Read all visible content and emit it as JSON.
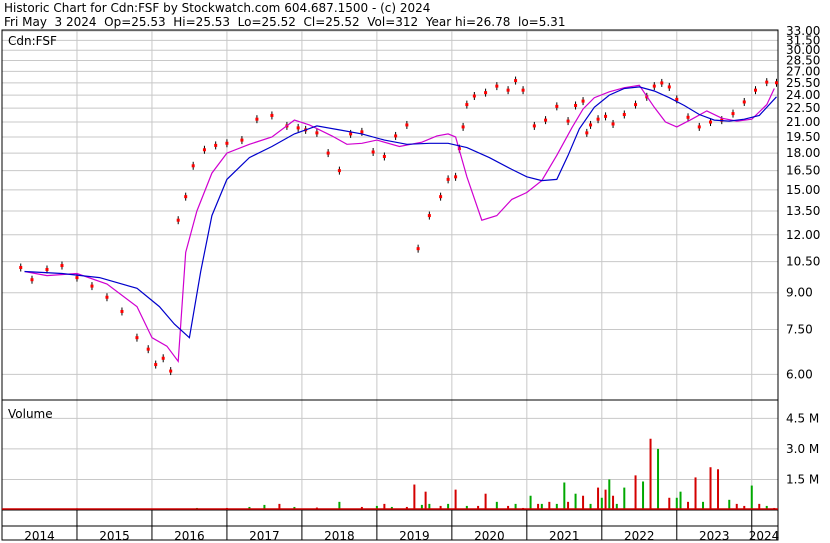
{
  "header": {
    "line1": "Historic Chart for Cdn:FSF by Stockwatch.com 604.687.1500 - (c) 2024",
    "line2": "Fri May  3 2024  Op=25.53  Hi=25.53  Lo=25.52  Cl=25.52  Vol=312  Year hi=26.78  lo=5.31"
  },
  "panels": {
    "price_label": "Cdn:FSF",
    "volume_label": "Volume"
  },
  "colors": {
    "up": "#00a800",
    "down": "#d40000",
    "close_dot": "#ff0000",
    "ma_short": "#d000d0",
    "ma_long": "#0000cc",
    "grid": "#c8c8c8",
    "frame": "#000000"
  },
  "chart_data": [
    {
      "type": "line",
      "panel": "price",
      "title": "Cdn:FSF",
      "y_scale": "log",
      "ylim": [
        5.31,
        33.0
      ],
      "y_ticks": [
        "33.00",
        "31.50",
        "30.00",
        "28.50",
        "27.00",
        "25.50",
        "24.00",
        "22.50",
        "21.00",
        "19.50",
        "18.00",
        "16.50",
        "15.00",
        "13.50",
        "12.00",
        "10.50",
        "9.00",
        "7.50",
        "6.00"
      ],
      "x_ticks": [
        "2014",
        "2015",
        "2016",
        "2017",
        "2018",
        "2019",
        "2020",
        "2021",
        "2022",
        "2023",
        "2024"
      ],
      "xlim": [
        2014.0,
        2024.35
      ],
      "series": [
        {
          "kind": "close",
          "x": [
            2014.25,
            2014.4,
            2014.6,
            2014.8,
            2015.0,
            2015.2,
            2015.4,
            2015.6,
            2015.8,
            2015.95,
            2016.05,
            2016.15,
            2016.25,
            2016.35,
            2016.45,
            2016.55,
            2016.7,
            2016.85,
            2017.0,
            2017.2,
            2017.4,
            2017.6,
            2017.8,
            2017.95,
            2018.05,
            2018.2,
            2018.35,
            2018.5,
            2018.65,
            2018.8,
            2018.95,
            2019.1,
            2019.25,
            2019.4,
            2019.55,
            2019.7,
            2019.85,
            2019.95,
            2020.05,
            2020.1,
            2020.15,
            2020.2,
            2020.3,
            2020.45,
            2020.6,
            2020.75,
            2020.85,
            2020.95,
            2021.1,
            2021.25,
            2021.4,
            2021.55,
            2021.65,
            2021.75,
            2021.8,
            2021.85,
            2021.95,
            2022.05,
            2022.15,
            2022.3,
            2022.45,
            2022.6,
            2022.7,
            2022.8,
            2022.9,
            2023.0,
            2023.15,
            2023.3,
            2023.45,
            2023.6,
            2023.75,
            2023.9,
            2024.05,
            2024.2,
            2024.33
          ],
          "values": [
            10.2,
            9.6,
            10.1,
            10.3,
            9.7,
            9.3,
            8.8,
            8.2,
            7.2,
            6.8,
            6.3,
            6.5,
            6.1,
            12.9,
            14.5,
            16.9,
            18.3,
            18.7,
            18.9,
            19.2,
            21.3,
            21.7,
            20.6,
            20.4,
            20.2,
            19.9,
            18.0,
            16.5,
            19.8,
            20.0,
            18.1,
            17.7,
            19.6,
            20.7,
            11.2,
            13.2,
            14.5,
            15.8,
            16.0,
            18.4,
            20.5,
            22.9,
            23.9,
            24.3,
            25.1,
            24.6,
            25.8,
            24.6,
            20.6,
            21.2,
            22.7,
            21.1,
            22.8,
            23.3,
            19.9,
            20.7,
            21.3,
            21.6,
            20.8,
            21.8,
            22.9,
            23.8,
            25.1,
            25.5,
            25.0,
            23.5,
            21.5,
            20.5,
            21.0,
            21.2,
            21.9,
            23.2,
            24.6,
            25.6,
            25.52
          ]
        },
        {
          "kind": "ma_short",
          "x": [
            2014.3,
            2014.6,
            2015.0,
            2015.4,
            2015.8,
            2016.0,
            2016.2,
            2016.35,
            2016.45,
            2016.6,
            2016.8,
            2017.0,
            2017.3,
            2017.6,
            2017.9,
            2018.1,
            2018.4,
            2018.6,
            2018.8,
            2019.0,
            2019.3,
            2019.6,
            2019.8,
            2019.95,
            2020.05,
            2020.2,
            2020.4,
            2020.6,
            2020.8,
            2021.0,
            2021.2,
            2021.4,
            2021.6,
            2021.75,
            2021.9,
            2022.1,
            2022.3,
            2022.5,
            2022.7,
            2022.85,
            2023.0,
            2023.2,
            2023.4,
            2023.6,
            2023.8,
            2024.0,
            2024.2,
            2024.3
          ],
          "values": [
            10.0,
            9.8,
            9.9,
            9.4,
            8.4,
            7.2,
            6.9,
            6.4,
            11.0,
            13.5,
            16.3,
            18.0,
            18.8,
            19.5,
            21.2,
            20.7,
            19.6,
            18.8,
            18.9,
            19.2,
            18.6,
            19.0,
            19.6,
            19.8,
            19.5,
            16.0,
            12.9,
            13.2,
            14.3,
            14.8,
            15.7,
            17.8,
            20.4,
            22.4,
            23.7,
            24.4,
            24.9,
            25.2,
            22.6,
            21.0,
            20.5,
            21.3,
            22.2,
            21.4,
            21.1,
            21.3,
            22.9,
            24.8
          ]
        },
        {
          "kind": "ma_long",
          "x": [
            2014.3,
            2014.8,
            2015.3,
            2015.8,
            2016.1,
            2016.3,
            2016.5,
            2016.65,
            2016.8,
            2017.0,
            2017.3,
            2017.6,
            2017.9,
            2018.2,
            2018.5,
            2018.8,
            2019.1,
            2019.4,
            2019.7,
            2019.95,
            2020.2,
            2020.5,
            2020.8,
            2021.0,
            2021.2,
            2021.4,
            2021.55,
            2021.7,
            2021.9,
            2022.1,
            2022.3,
            2022.5,
            2022.7,
            2022.9,
            2023.1,
            2023.3,
            2023.5,
            2023.7,
            2023.9,
            2024.1,
            2024.33
          ],
          "values": [
            10.0,
            9.9,
            9.7,
            9.2,
            8.4,
            7.7,
            7.2,
            10.0,
            13.2,
            15.8,
            17.6,
            18.6,
            19.8,
            20.6,
            20.2,
            19.8,
            19.2,
            18.8,
            18.9,
            18.9,
            18.5,
            17.6,
            16.6,
            16.0,
            15.7,
            15.8,
            17.8,
            20.3,
            22.6,
            24.0,
            24.8,
            25.0,
            24.5,
            23.7,
            22.8,
            21.8,
            21.2,
            21.1,
            21.3,
            21.7,
            23.8
          ]
        }
      ]
    },
    {
      "type": "bar",
      "panel": "volume",
      "title": "Volume",
      "y_ticks": [
        "4.5 M",
        "3.0 M",
        "1.5 M"
      ],
      "ylim": [
        0,
        5.4
      ],
      "x": [
        2014.3,
        2014.6,
        2015.0,
        2015.4,
        2015.8,
        2016.2,
        2016.6,
        2017.0,
        2017.3,
        2017.5,
        2017.7,
        2017.9,
        2018.2,
        2018.5,
        2018.8,
        2019.0,
        2019.1,
        2019.2,
        2019.4,
        2019.5,
        2019.6,
        2019.65,
        2019.7,
        2019.85,
        2019.95,
        2020.05,
        2020.2,
        2020.35,
        2020.45,
        2020.6,
        2020.75,
        2020.85,
        2020.95,
        2021.05,
        2021.15,
        2021.2,
        2021.3,
        2021.4,
        2021.5,
        2021.55,
        2021.65,
        2021.75,
        2021.85,
        2021.95,
        2022.0,
        2022.05,
        2022.1,
        2022.15,
        2022.2,
        2022.3,
        2022.45,
        2022.55,
        2022.65,
        2022.75,
        2022.9,
        2023.0,
        2023.05,
        2023.15,
        2023.25,
        2023.35,
        2023.45,
        2023.55,
        2023.7,
        2023.8,
        2023.9,
        2024.0,
        2024.1,
        2024.2,
        2024.3
      ],
      "values": [
        0.05,
        0.05,
        0.08,
        0.06,
        0.05,
        0.07,
        0.1,
        0.1,
        0.15,
        0.25,
        0.3,
        0.15,
        0.12,
        0.4,
        0.15,
        0.2,
        0.3,
        0.15,
        0.15,
        1.25,
        0.25,
        0.9,
        0.3,
        0.2,
        0.3,
        1.0,
        0.2,
        0.2,
        0.8,
        0.4,
        0.2,
        0.3,
        0.1,
        0.7,
        0.3,
        0.3,
        0.4,
        0.3,
        1.35,
        0.4,
        0.8,
        0.7,
        0.3,
        1.1,
        0.6,
        1.0,
        1.5,
        0.7,
        0.3,
        1.1,
        1.7,
        1.4,
        3.5,
        3.0,
        0.6,
        0.6,
        0.9,
        0.4,
        1.6,
        0.4,
        2.1,
        2.0,
        0.5,
        0.3,
        0.2,
        1.2,
        0.3,
        0.2,
        0.1
      ],
      "up": [
        false,
        true,
        false,
        true,
        false,
        true,
        true,
        false,
        true,
        true,
        false,
        true,
        false,
        true,
        false,
        true,
        false,
        true,
        false,
        false,
        true,
        false,
        true,
        false,
        true,
        false,
        true,
        false,
        false,
        true,
        false,
        true,
        false,
        true,
        false,
        true,
        false,
        true,
        true,
        false,
        true,
        false,
        true,
        false,
        true,
        false,
        true,
        false,
        true,
        true,
        false,
        true,
        false,
        true,
        false,
        true,
        true,
        false,
        false,
        true,
        false,
        false,
        true,
        false,
        false,
        true,
        false,
        true,
        false
      ]
    }
  ]
}
